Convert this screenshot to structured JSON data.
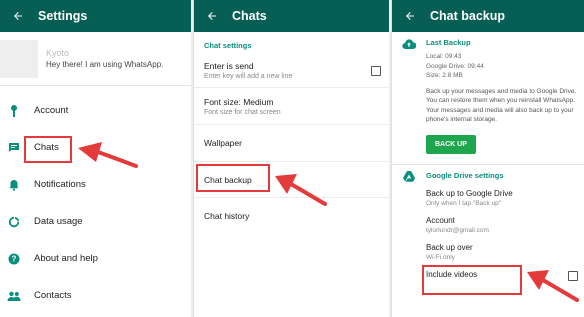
{
  "colors": {
    "appbar": "#075e54",
    "accent": "#0a8f7d",
    "button": "#1da64e",
    "highlight": "#e33a3a"
  },
  "settings": {
    "title": "Settings",
    "profile": {
      "name": "Kyoto",
      "status": "Hey there! I am using WhatsApp."
    },
    "items": [
      {
        "label": "Account",
        "icon": "key-icon"
      },
      {
        "label": "Chats",
        "icon": "chat-icon"
      },
      {
        "label": "Notifications",
        "icon": "bell-icon"
      },
      {
        "label": "Data usage",
        "icon": "data-usage-icon"
      },
      {
        "label": "About and help",
        "icon": "help-icon"
      },
      {
        "label": "Contacts",
        "icon": "contacts-icon"
      }
    ]
  },
  "chats": {
    "title": "Chats",
    "section": "Chat settings",
    "enter_is_send": {
      "title": "Enter is send",
      "subtitle": "Enter key will add a new line"
    },
    "font_size": {
      "title": "Font size: Medium",
      "subtitle": "Font size for chat screen"
    },
    "wallpaper": "Wallpaper",
    "chat_backup": "Chat backup",
    "chat_history": "Chat history"
  },
  "chat_backup": {
    "title": "Chat backup",
    "last_backup_title": "Last Backup",
    "local": "Local: 09:43",
    "google_drive": "Google Drive: 09:44",
    "size": "Size: 2.8 MB",
    "description": "Back up your messages and media to Google Drive. You can restore them when you reinstall WhatsApp. Your messages and media will also back up to your phone's internal storage.",
    "backup_button": "BACK UP",
    "gd_settings_title": "Google Drive settings",
    "backup_to_gd": {
      "title": "Back up to Google Drive",
      "subtitle": "Only when I tap \"Back up\""
    },
    "account": {
      "title": "Account",
      "subtitle": "tylorlundr@gmail.com"
    },
    "backup_over": {
      "title": "Back up over",
      "subtitle": "Wi-Fi only"
    },
    "include_videos": {
      "title": "Include videos"
    }
  }
}
